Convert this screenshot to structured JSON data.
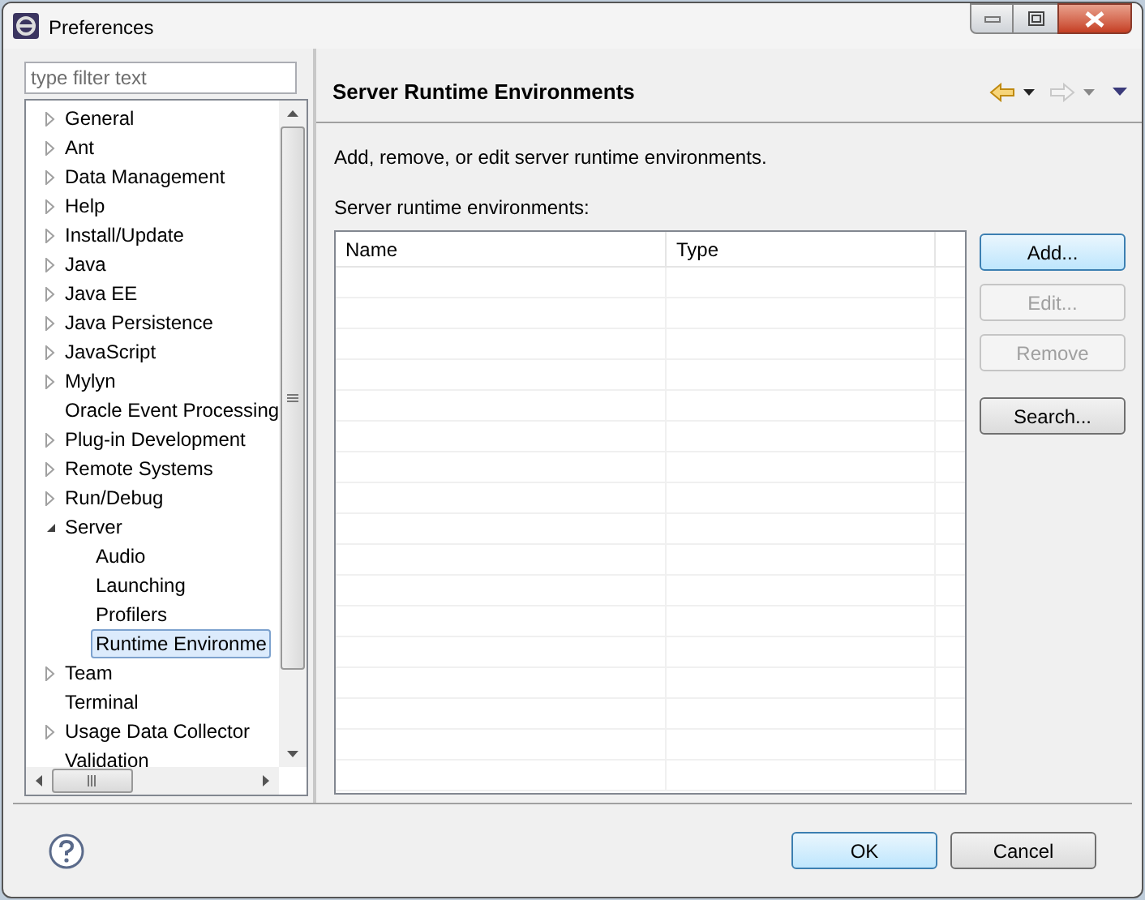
{
  "window": {
    "title": "Preferences"
  },
  "filter": {
    "placeholder": "type filter text"
  },
  "tree": [
    {
      "label": "General",
      "kind": "branch",
      "expanded": false
    },
    {
      "label": "Ant",
      "kind": "branch",
      "expanded": false
    },
    {
      "label": "Data Management",
      "kind": "branch",
      "expanded": false
    },
    {
      "label": "Help",
      "kind": "branch",
      "expanded": false
    },
    {
      "label": "Install/Update",
      "kind": "branch",
      "expanded": false
    },
    {
      "label": "Java",
      "kind": "branch",
      "expanded": false
    },
    {
      "label": "Java EE",
      "kind": "branch",
      "expanded": false
    },
    {
      "label": "Java Persistence",
      "kind": "branch",
      "expanded": false
    },
    {
      "label": "JavaScript",
      "kind": "branch",
      "expanded": false
    },
    {
      "label": "Mylyn",
      "kind": "branch",
      "expanded": false
    },
    {
      "label": "Oracle Event Processing",
      "kind": "leaf"
    },
    {
      "label": "Plug-in Development",
      "kind": "branch",
      "expanded": false
    },
    {
      "label": "Remote Systems",
      "kind": "branch",
      "expanded": false
    },
    {
      "label": "Run/Debug",
      "kind": "branch",
      "expanded": false
    },
    {
      "label": "Server",
      "kind": "branch",
      "expanded": true,
      "children": [
        {
          "label": "Audio",
          "selected": false
        },
        {
          "label": "Launching",
          "selected": false
        },
        {
          "label": "Profilers",
          "selected": false
        },
        {
          "label": "Runtime Environme",
          "selected": true
        }
      ]
    },
    {
      "label": "Team",
      "kind": "branch",
      "expanded": false
    },
    {
      "label": "Terminal",
      "kind": "leaf"
    },
    {
      "label": "Usage Data Collector",
      "kind": "branch",
      "expanded": false
    },
    {
      "label": "Validation",
      "kind": "leaf"
    }
  ],
  "page": {
    "title": "Server Runtime Environments",
    "description": "Add, remove, or edit server runtime environments.",
    "list_label": "Server runtime environments:"
  },
  "table": {
    "columns": [
      "Name",
      "Type"
    ]
  },
  "side_buttons": [
    {
      "label": "Add...",
      "disabled": false,
      "focused": true
    },
    {
      "label": "Edit...",
      "disabled": true,
      "focused": false
    },
    {
      "label": "Remove",
      "disabled": true,
      "focused": false
    },
    {
      "label": "Search...",
      "disabled": false,
      "focused": false
    }
  ],
  "footer_buttons": [
    {
      "label": "OK",
      "default": true
    },
    {
      "label": "Cancel",
      "default": false
    }
  ]
}
